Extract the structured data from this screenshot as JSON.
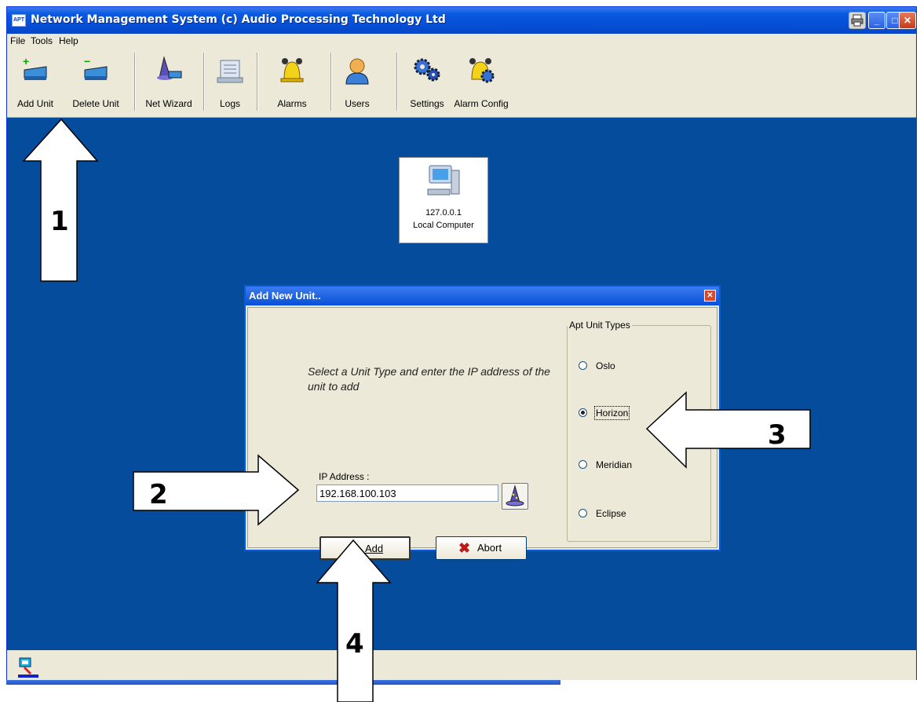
{
  "window": {
    "title": "Network Management System  (c) Audio Processing Technology Ltd",
    "app_icon_text": "APT",
    "buttons": {
      "minimize": "_",
      "maximize": "□",
      "close": "✕"
    }
  },
  "menu": [
    "File",
    "Tools",
    "Help"
  ],
  "toolbar": [
    {
      "label": "Add Unit",
      "icon": "add-unit-icon"
    },
    {
      "label": "Delete Unit",
      "icon": "delete-unit-icon"
    },
    {
      "label": "Net Wizard",
      "icon": "wizard-icon"
    },
    {
      "label": "Logs",
      "icon": "logs-icon"
    },
    {
      "label": "Alarms",
      "icon": "alarm-bell-icon"
    },
    {
      "label": "Users",
      "icon": "user-icon"
    },
    {
      "label": "Settings",
      "icon": "gears-icon"
    },
    {
      "label": "Alarm Config",
      "icon": "alarm-config-icon"
    }
  ],
  "computer": {
    "ip": "127.0.0.1",
    "name": "Local Computer"
  },
  "dialog": {
    "title": "Add New Unit..",
    "instruction": "Select a Unit Type and enter the IP address of the unit to add",
    "ip_label": "IP Address :",
    "ip_value": "192.168.100.103",
    "add_label": "Add",
    "abort_label": "Abort",
    "types_title": "Apt Unit Types",
    "types": [
      {
        "label": "Oslo",
        "selected": false
      },
      {
        "label": "Horizon",
        "selected": true
      },
      {
        "label": "Meridian",
        "selected": false
      },
      {
        "label": "Eclipse",
        "selected": false
      }
    ]
  },
  "callouts": [
    "1",
    "2",
    "3",
    "4"
  ],
  "colors": {
    "workspace": "#054c9c",
    "titlebar": "#0550d8",
    "chrome": "#ece9d8"
  }
}
